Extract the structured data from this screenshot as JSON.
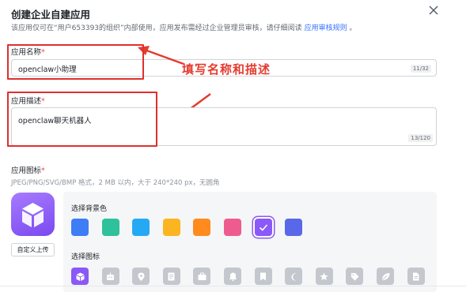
{
  "dialog": {
    "title": "创建企业自建应用",
    "description_prefix": "该应用仅可在“用户653393的组织”内部使用，应用发布需经过企业管理员审核，请仔细阅读",
    "description_link": "应用审核规则",
    "description_suffix": "。"
  },
  "name_field": {
    "label": "应用名称",
    "required_mark": "*",
    "value": "openclaw小助理",
    "counter": "11/32"
  },
  "desc_field": {
    "label": "应用描述",
    "required_mark": "*",
    "value": "openclaw聊天机器人",
    "counter": "13/120"
  },
  "annotation": {
    "text": "填写名称和描述",
    "color": "#e53b2f"
  },
  "icon_section": {
    "label": "应用图标",
    "required_mark": "*",
    "hint": "JPEG/PNG/SVG/BMP 格式，2 MB 以内，大于 240*240 px，无圆角",
    "upload_label": "自定义上传",
    "bg_label": "选择背景色",
    "icon_label": "选择图标",
    "colors": [
      "#3d7df5",
      "#2fc19a",
      "#26a9f5",
      "#fbb520",
      "#ff8a1e",
      "#ee5c8f",
      "#8a59f7",
      "#5868e8"
    ],
    "selected_color_index": 6,
    "icons": [
      "cube-icon",
      "robot-icon",
      "location-pin-icon",
      "document-icon",
      "briefcase-icon",
      "bell-icon",
      "bookmark-icon",
      "moon-icon",
      "star-icon",
      "tag-icon",
      "leaf-icon",
      "file-text-icon"
    ],
    "selected_icon_index": 0
  }
}
